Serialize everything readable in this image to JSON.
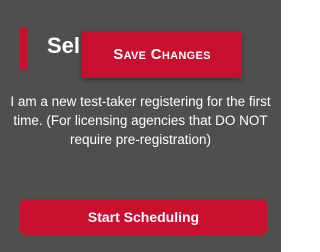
{
  "card": {
    "title": "Sel",
    "description": "I am a new test-taker registering for the first time. (For licensing agencies that DO NOT require pre-registration)",
    "primary_button_label": "Start Scheduling"
  },
  "overlay": {
    "save_changes_label": "Save Changes"
  },
  "colors": {
    "card_background": "#4f4f4f",
    "accent": "#c8102e",
    "text": "#ffffff"
  }
}
